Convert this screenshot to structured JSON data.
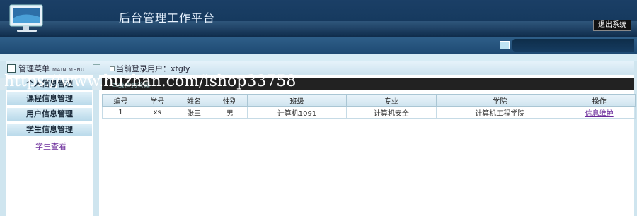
{
  "header": {
    "title": "后台管理工作平台",
    "logout_label": "退出系统"
  },
  "menu": {
    "title": "管理菜单",
    "subtitle": "MAIN MENU"
  },
  "current_user": "当前登录用户：xtgly",
  "watermark": "https://www.huzhan.com/ishop33758",
  "faint_label": "本级信息管理",
  "sidebar": {
    "items": [
      {
        "label": "个人信息管理"
      },
      {
        "label": "课程信息管理"
      },
      {
        "label": "用户信息管理"
      },
      {
        "label": "学生信息管理"
      }
    ],
    "sub_item": "学生查看"
  },
  "table": {
    "headers": [
      "编号",
      "学号",
      "姓名",
      "性别",
      "班级",
      "专业",
      "学院",
      "操作"
    ],
    "rows": [
      [
        "1",
        "xs",
        "张三",
        "男",
        "计算机1091",
        "计算机安全",
        "计算机工程学院",
        "信息维护"
      ]
    ]
  }
}
